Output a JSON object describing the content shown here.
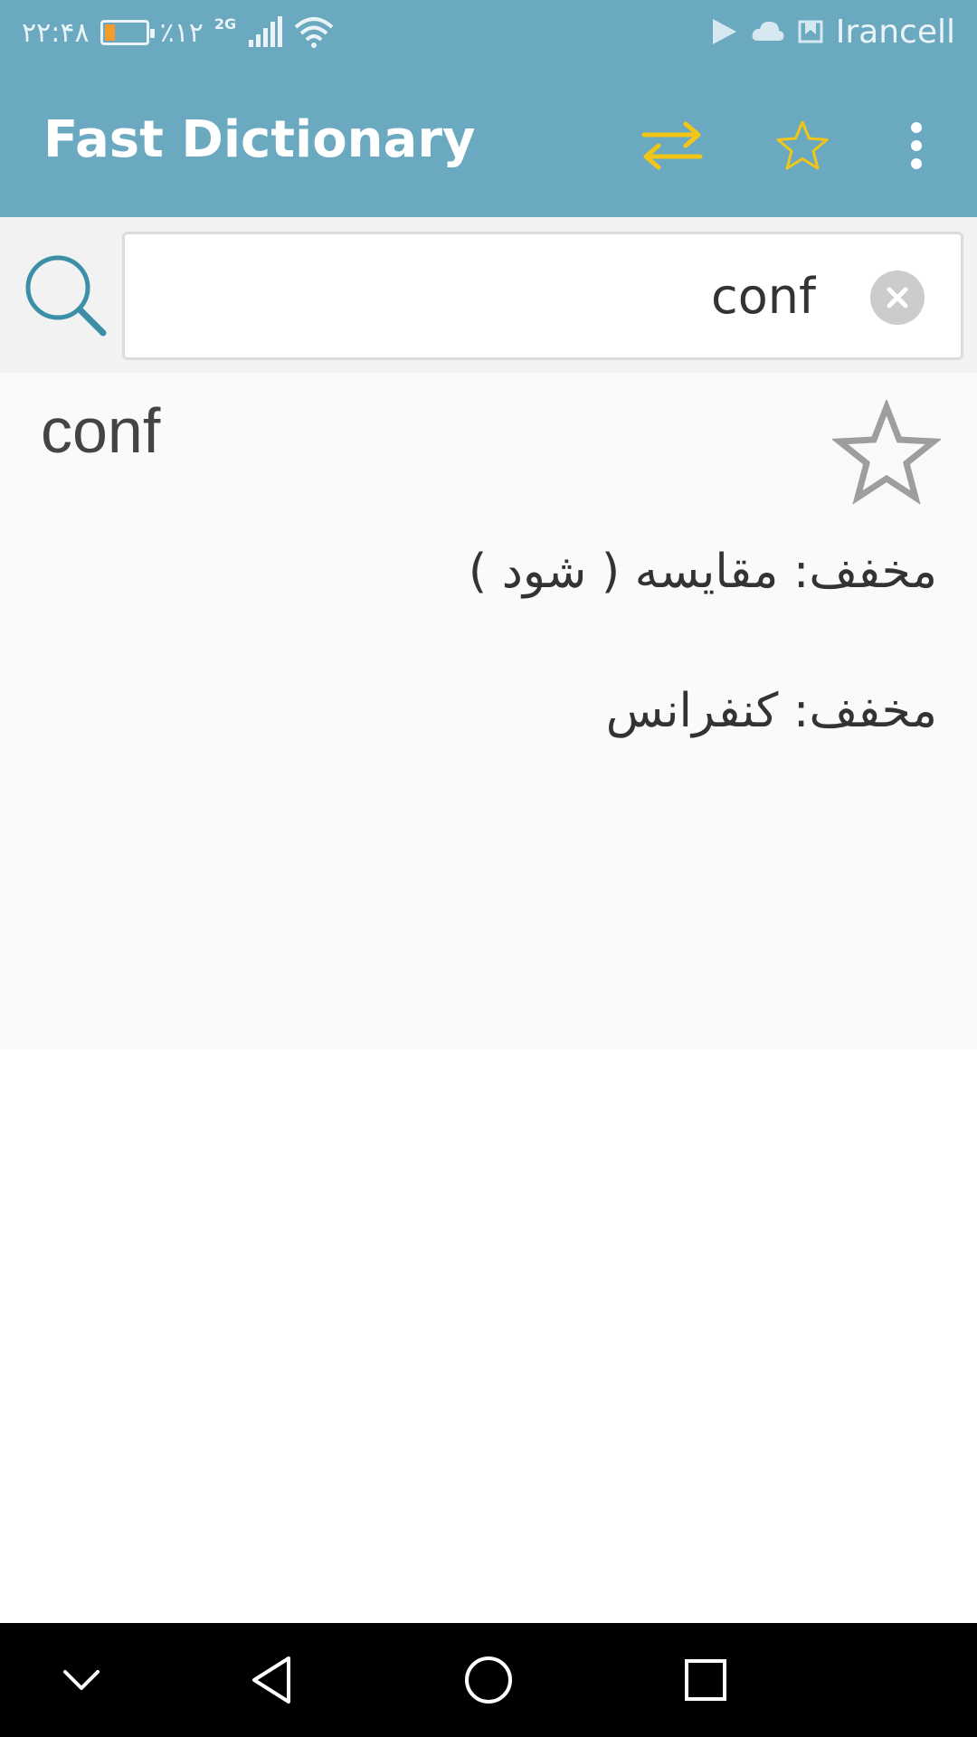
{
  "status_bar": {
    "time": "۲۲:۴۸",
    "battery_text": "٪۱۲",
    "battery_level_percent": 12,
    "battery_fill_color": "#f39c2b",
    "network_type": "2G",
    "carrier": "Irancell",
    "icons": [
      "battery-icon",
      "signal-icon",
      "wifi-icon",
      "play-store-icon",
      "cloud-icon",
      "notification-icon"
    ]
  },
  "app_bar": {
    "title": "Fast Dictionary",
    "background_color": "#6aa9bf",
    "accent_color": "#f2c618",
    "actions": [
      "swap-arrows-icon",
      "favorite-star-icon",
      "more-vert-icon"
    ]
  },
  "search": {
    "value": "conf",
    "icons": [
      "search-icon",
      "clear-icon"
    ]
  },
  "result": {
    "word": "conf",
    "meanings": [
      "مخفف: مقایسه ( شود )",
      "مخفف: کنفرانس"
    ],
    "icons": [
      "bookmark-star-icon"
    ]
  },
  "nav_bar": {
    "buttons": [
      "collapse-chevron-icon",
      "back-icon",
      "home-icon",
      "recents-icon"
    ]
  }
}
